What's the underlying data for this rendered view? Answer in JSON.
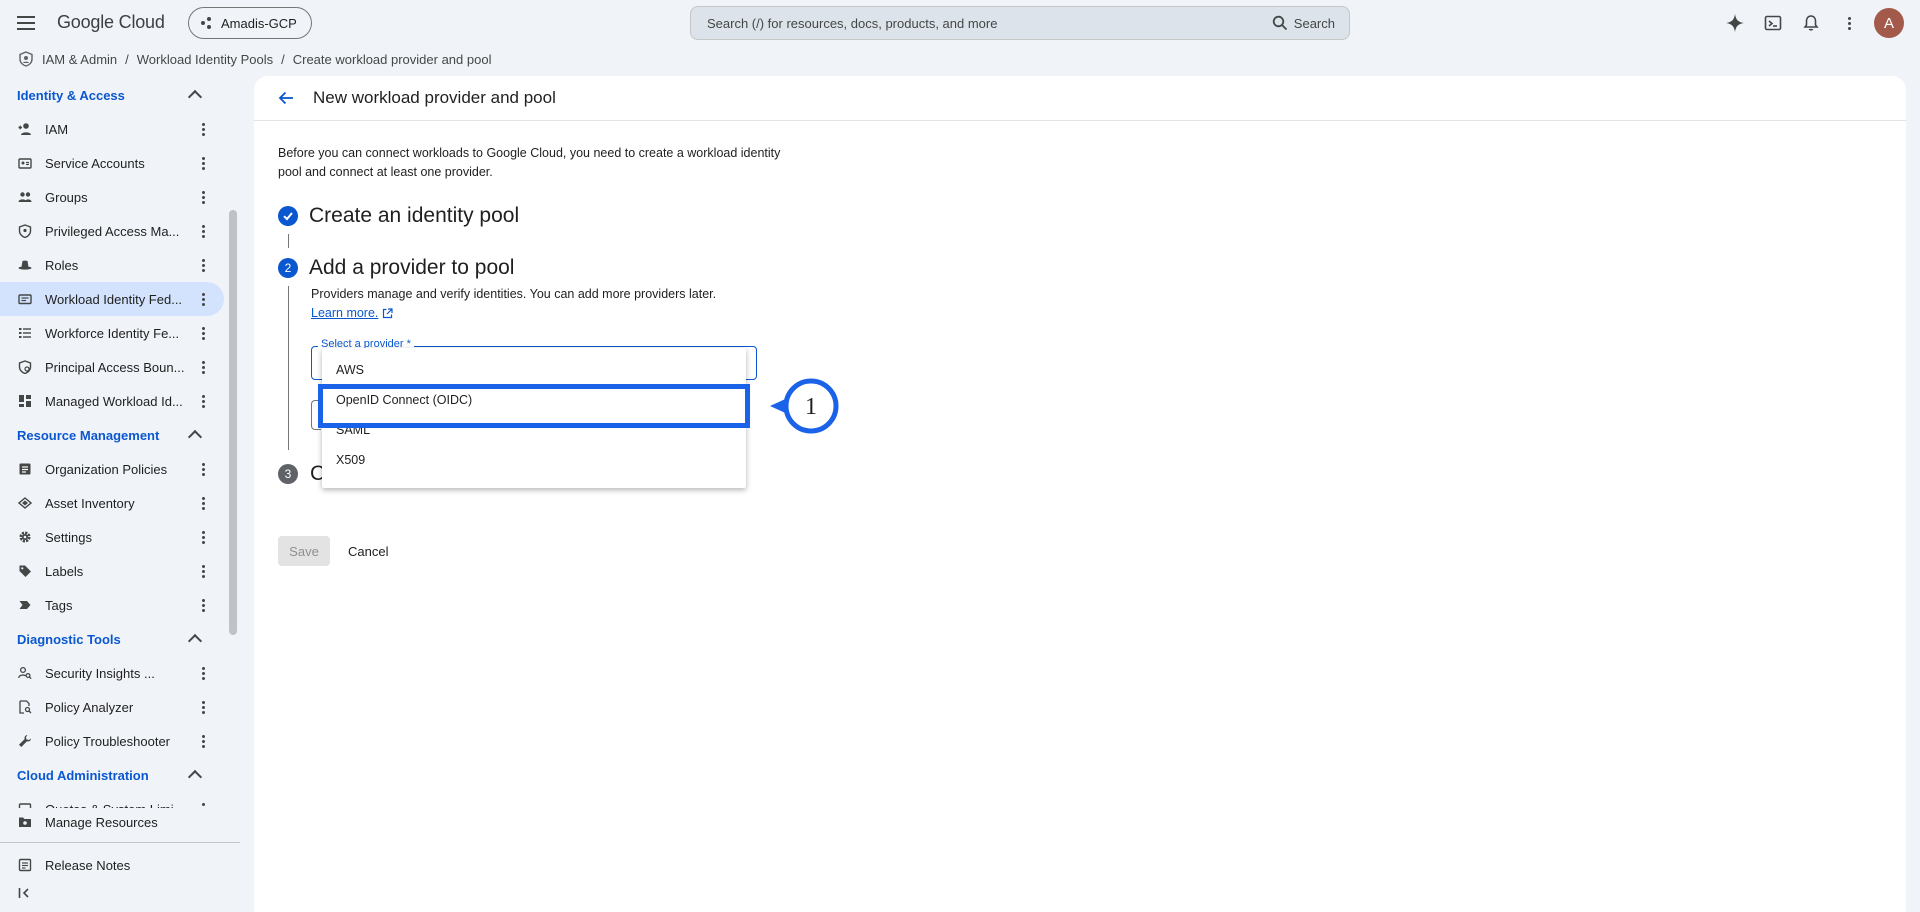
{
  "header": {
    "logo": "Google Cloud",
    "project": "Amadis-GCP",
    "search_placeholder": "Search (/) for resources, docs, products, and more",
    "search_button": "Search",
    "avatar_initial": "A"
  },
  "breadcrumb": [
    "IAM & Admin",
    "Workload Identity Pools",
    "Create workload provider and pool"
  ],
  "sidebar": {
    "sections": [
      {
        "title": "Identity & Access",
        "items": [
          "IAM",
          "Service Accounts",
          "Groups",
          "Privileged Access Ma...",
          "Roles",
          "Workload Identity Fed...",
          "Workforce Identity Fe...",
          "Principal Access Boun...",
          "Managed Workload Id..."
        ]
      },
      {
        "title": "Resource Management",
        "items": [
          "Organization Policies",
          "Asset Inventory",
          "Settings",
          "Labels",
          "Tags"
        ]
      },
      {
        "title": "Diagnostic Tools",
        "items": [
          "Security Insights ...",
          "Policy Analyzer",
          "Policy Troubleshooter"
        ]
      },
      {
        "title": "Cloud Administration",
        "items": [
          "Quotas & System Limi..."
        ]
      }
    ],
    "bottom": [
      "Manage Resources",
      "Release Notes"
    ]
  },
  "main": {
    "title": "New workload provider and pool",
    "intro": "Before you can connect workloads to Google Cloud, you need to create a workload identity pool and connect at least one provider.",
    "step1": {
      "title": "Create an identity pool"
    },
    "step2": {
      "number": "2",
      "title": "Add a provider to pool",
      "desc": "Providers manage and verify identities. You can add more providers later.",
      "learn_more": "Learn more."
    },
    "step3": {
      "number": "3",
      "partial": "C"
    },
    "select_label": "Select a provider *",
    "provider_options": [
      "AWS",
      "OpenID Connect (OIDC)",
      "SAML",
      "X509"
    ],
    "save": "Save",
    "cancel": "Cancel"
  },
  "annotation": {
    "number": "1"
  },
  "colors": {
    "accent": "#0b57d0",
    "highlight": "#1a62e8",
    "active_nav": "#d3e3fd"
  }
}
